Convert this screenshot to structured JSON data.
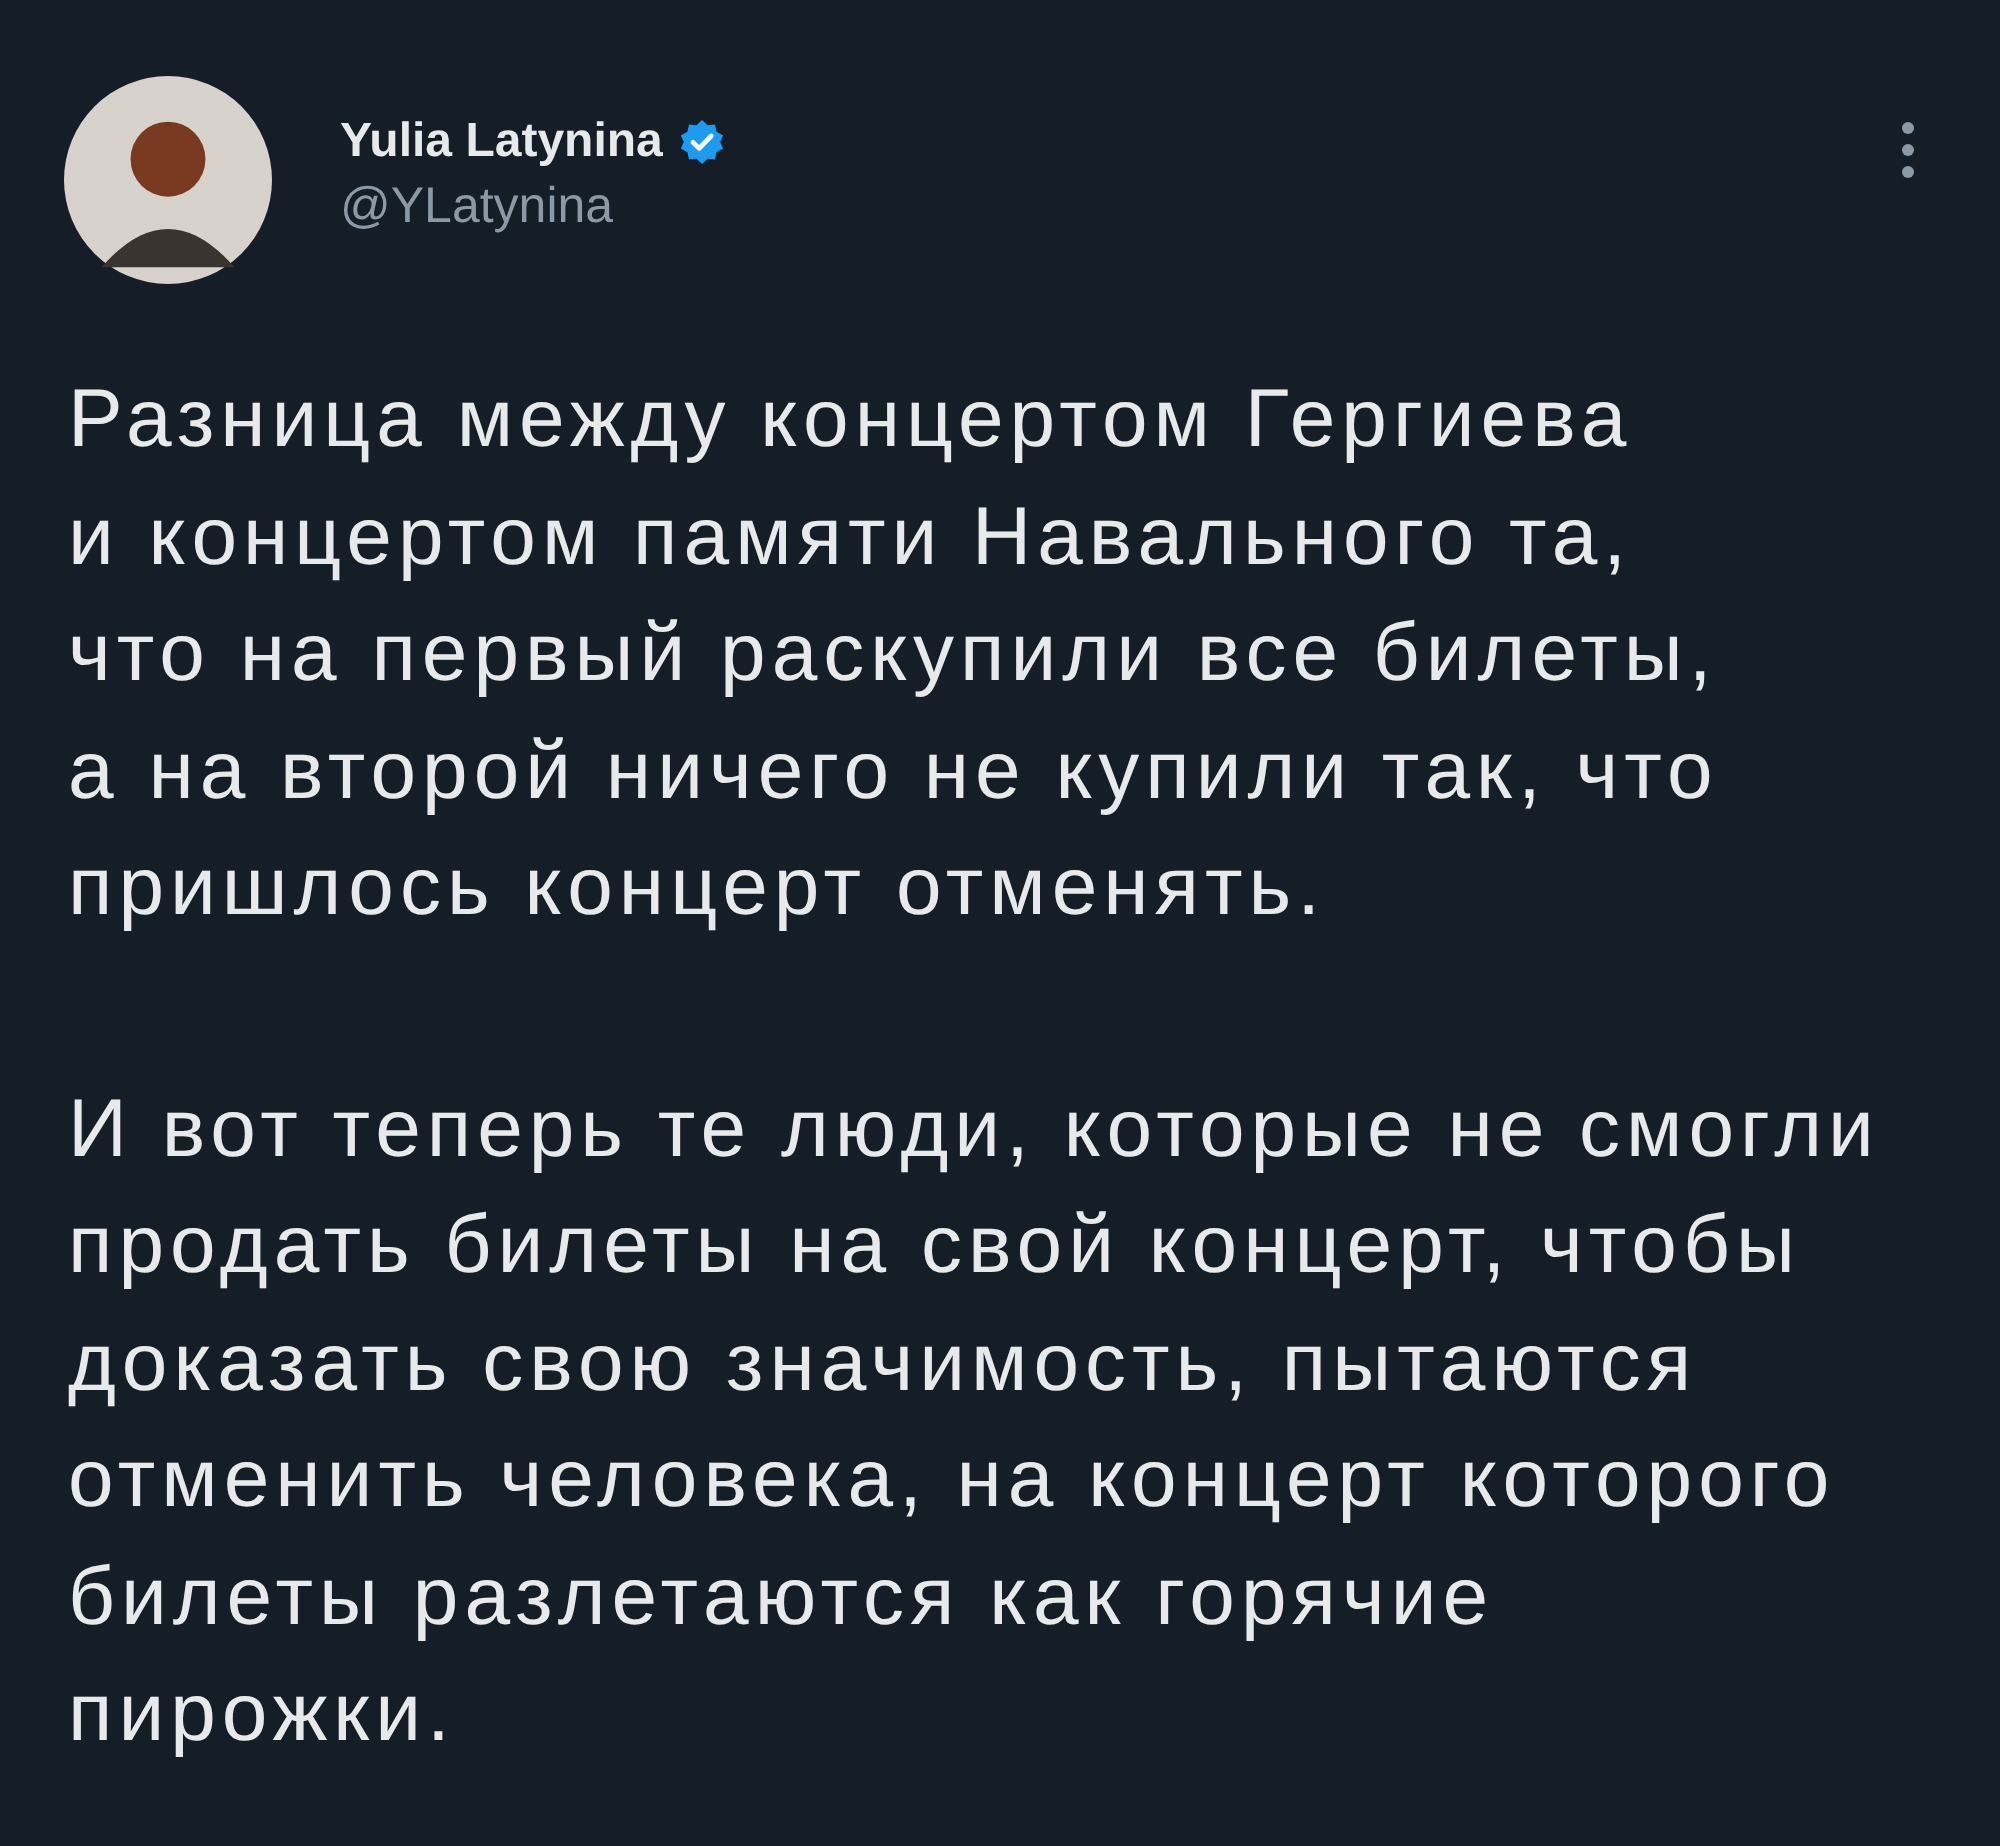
{
  "author": {
    "name": "Yulia Latynina",
    "verified": true,
    "handle": "@YLatynina"
  },
  "paragraphs": [
    "Разница между концертом Гергиева\nи концертом памяти Навального та,\nчто на первый раскупили все билеты,\nа на второй ничего не купили так, что\nпришлось концерт отменять.",
    "И вот теперь те люди, которые не смогли\nпродать билеты на свой концерт, чтобы\nдоказать свою значимость, пытаются\nотменить человека, на концерт которого\nбилеты разлетаются как горячие\nпирожки."
  ]
}
